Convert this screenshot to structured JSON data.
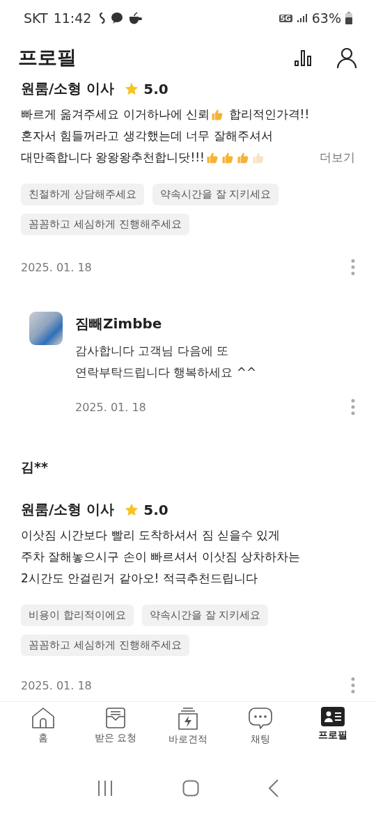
{
  "status_bar": {
    "carrier": "SKT",
    "time": "11:42",
    "network": "5G",
    "battery": "63%"
  },
  "header": {
    "title": "프로필"
  },
  "reviews": [
    {
      "category": "원룸/소형 이사",
      "rating": "5.0",
      "body": [
        [
          {
            "kind": "text",
            "text": "빠르게 옮겨주세요 이거하나에 신뢰"
          },
          {
            "kind": "thumb",
            "faded": false
          },
          {
            "kind": "text",
            "text": " 합리적인가격!!"
          }
        ],
        [
          {
            "kind": "text",
            "text": "혼자서 힘들꺼라고 생각했는데 너무 잘해주셔서"
          }
        ],
        [
          {
            "kind": "text",
            "text": "대만족합니다 왕왕왕추천합니닷!!!"
          },
          {
            "kind": "thumb",
            "faded": false
          },
          {
            "kind": "thumb",
            "faded": false
          },
          {
            "kind": "thumb",
            "faded": false
          },
          {
            "kind": "thumb",
            "faded": true
          }
        ]
      ],
      "more": "더보기",
      "tags": [
        "친절하게 상담해주세요",
        "약속시간을 잘 지키세요",
        "꼼꼼하고 세심하게 진행해주세요"
      ],
      "date": "2025. 01. 18",
      "reply": {
        "name": "짐빼Zimbbe",
        "lines": [
          "감사합니다 고객님 다음에 또",
          "연락부탁드립니다 행복하세요 ^^"
        ],
        "date": "2025. 01. 18"
      }
    },
    {
      "author": "김**",
      "category": "원룸/소형 이사",
      "rating": "5.0",
      "body": [
        [
          {
            "kind": "text",
            "text": "이삿짐 시간보다 빨리 도착하셔서 짐 싣을수 있게"
          }
        ],
        [
          {
            "kind": "text",
            "text": "주차 잘해놓으시구 손이 빠르셔서 이삿짐 상차하차는"
          }
        ],
        [
          {
            "kind": "text",
            "text": "2시간도 안걸린거 같아오! 적극추천드립니다"
          }
        ]
      ],
      "tags": [
        "비용이 합리적이에요",
        "약속시간을 잘 지키세요",
        "꼼꼼하고 세심하게 진행해주세요"
      ],
      "date": "2025. 01. 18"
    }
  ],
  "bottom_nav": [
    {
      "kind": "home",
      "label": "홈",
      "selected": false
    },
    {
      "kind": "inbox",
      "label": "받은 요청",
      "selected": false
    },
    {
      "kind": "quote",
      "label": "바로견적",
      "selected": false
    },
    {
      "kind": "chat",
      "label": "채팅",
      "selected": false
    },
    {
      "kind": "profile",
      "label": "프로필",
      "selected": true
    }
  ]
}
